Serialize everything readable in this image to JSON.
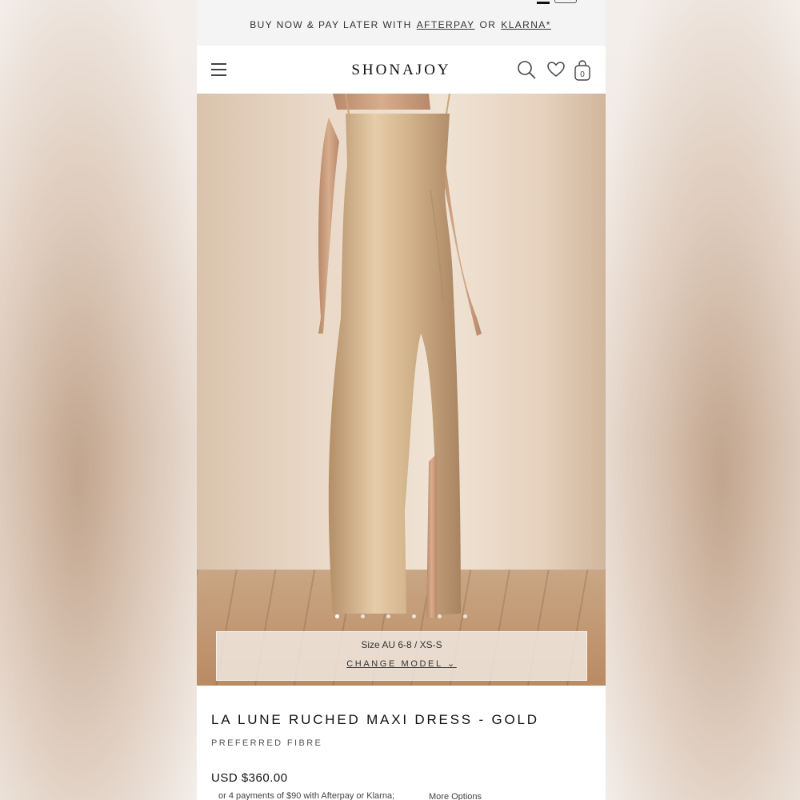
{
  "promo": {
    "prefix": "BUY NOW & PAY LATER WITH",
    "afterpay": "AFTERPAY",
    "or": "OR",
    "klarna": "KLARNA*"
  },
  "header": {
    "logo": "SHONAJOY",
    "cart_count": "0",
    "icons": [
      "hamburger-menu-icon",
      "search-icon",
      "heart-icon",
      "shopping-bag-icon"
    ]
  },
  "gallery": {
    "image_count": 6,
    "active_index": 0,
    "model_size": "Size AU 6-8 / XS-S",
    "change_model": "CHANGE MODEL"
  },
  "product": {
    "title": "LA LUNE RUCHED MAXI DRESS - GOLD",
    "fibre": "PREFERRED FIBRE",
    "price": "USD $360.00",
    "installments": "or 4 payments of $90 with Afterpay or Klarna;",
    "more_options": "More Options"
  },
  "colors": {
    "promo_bg": "#f4f4f4",
    "text": "#111111",
    "dress": "#c9a87f"
  }
}
